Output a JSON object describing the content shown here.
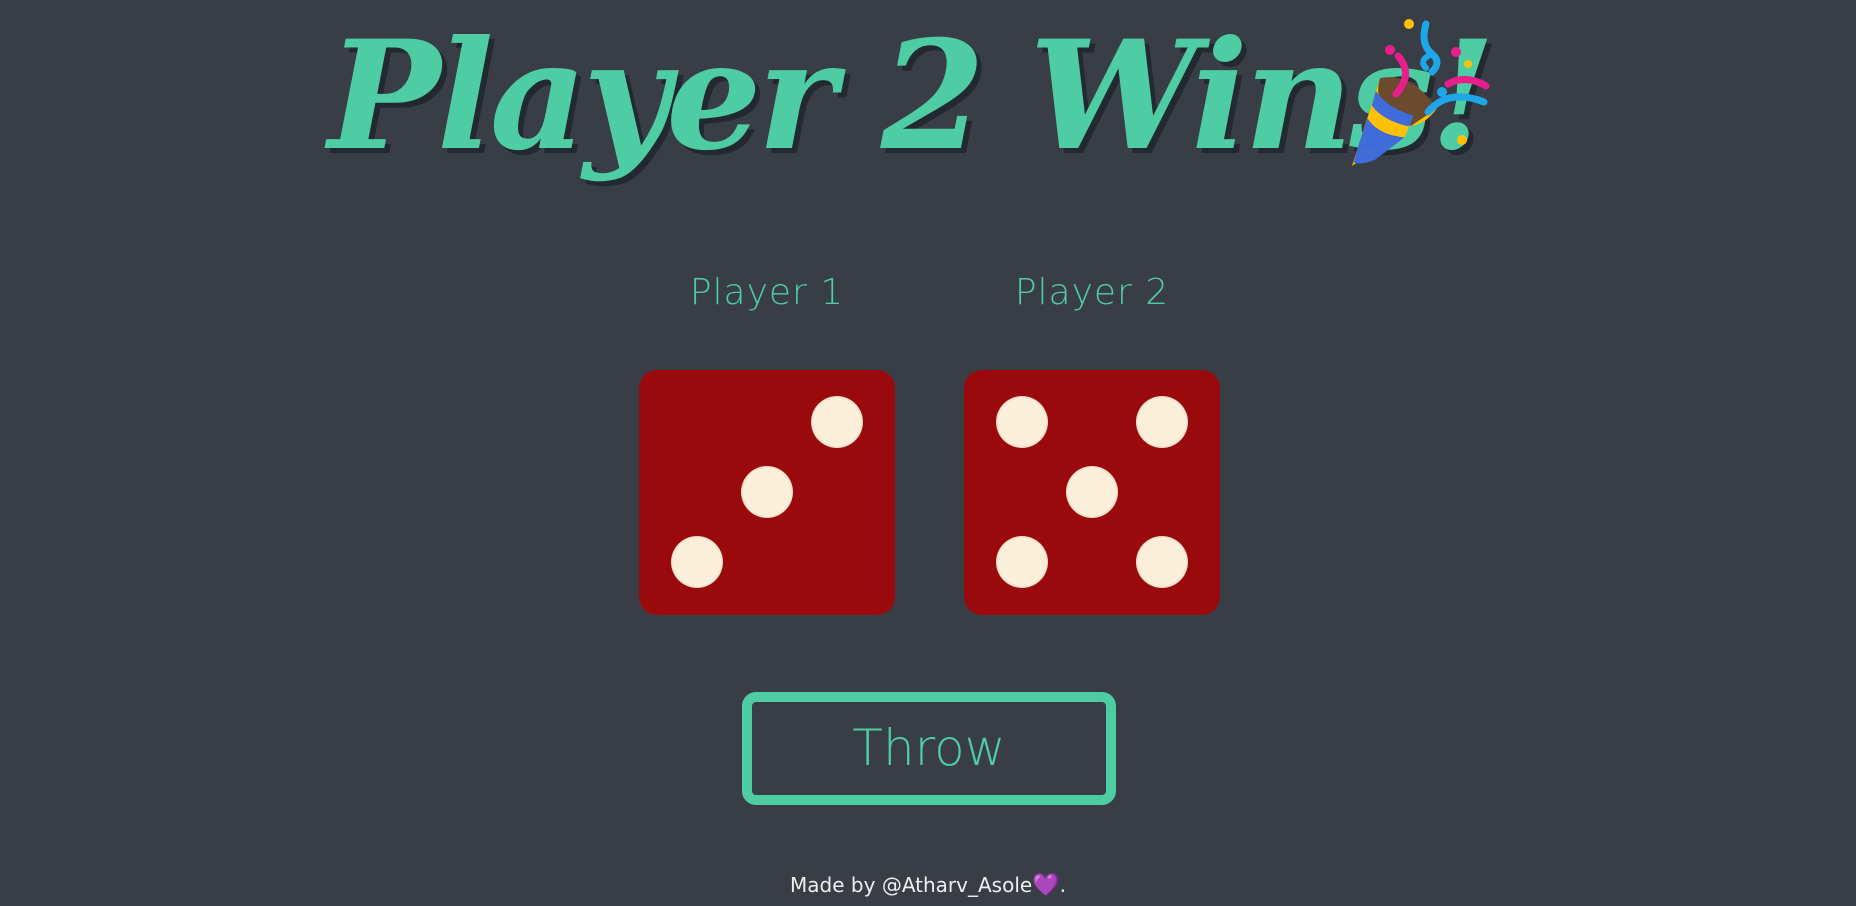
{
  "title": {
    "text": "Player 2 Wins!",
    "icon": "party-popper-icon"
  },
  "players": [
    {
      "label": "Player 1",
      "die_value": 3
    },
    {
      "label": "Player 2",
      "die_value": 5
    }
  ],
  "actions": {
    "throw_label": "Throw"
  },
  "footer": {
    "made_by": "Made by",
    "author": "@Atharv_Asole",
    "heart_icon": "purple-heart-icon",
    "heart_char": "💜",
    "suffix": "."
  },
  "colors": {
    "background": "#393E46",
    "accent": "#4ECCA3",
    "die_face": "#9A0A0D",
    "pip": "#FBEFD9",
    "heart": "#8B5FD6"
  }
}
